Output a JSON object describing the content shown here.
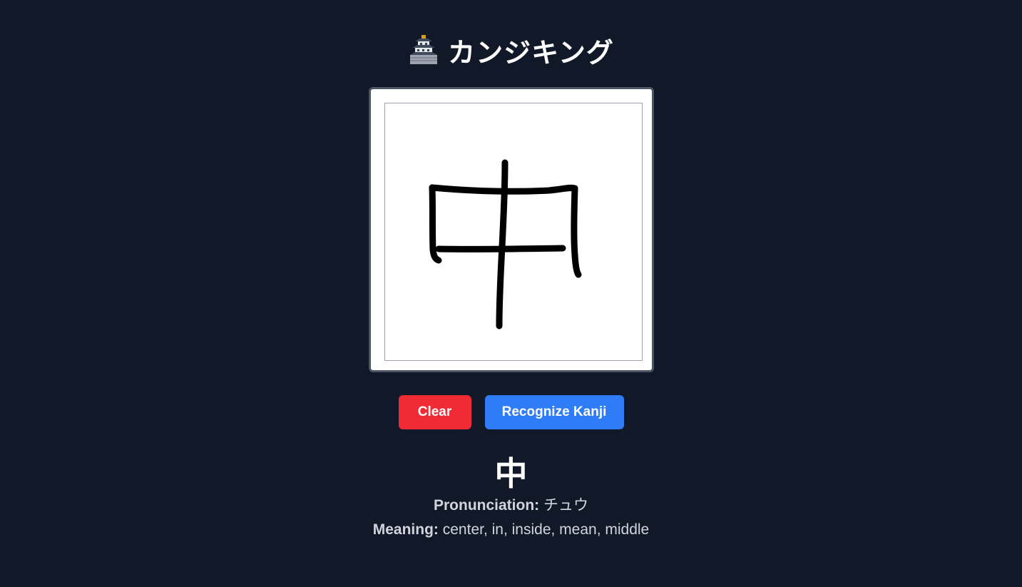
{
  "app": {
    "title": "カンジキング",
    "icon": "japanese-castle-icon"
  },
  "canvas": {
    "stroke_color": "#000000",
    "background": "#ffffff"
  },
  "buttons": {
    "clear_label": "Clear",
    "recognize_label": "Recognize Kanji",
    "clear_color": "#ef2b36",
    "recognize_color": "#2f7cf6"
  },
  "result": {
    "kanji": "中",
    "pronunciation_label": "Pronunciation:",
    "pronunciation_value": "チュウ",
    "meaning_label": "Meaning:",
    "meaning_value": "center, in, inside, mean, middle"
  }
}
